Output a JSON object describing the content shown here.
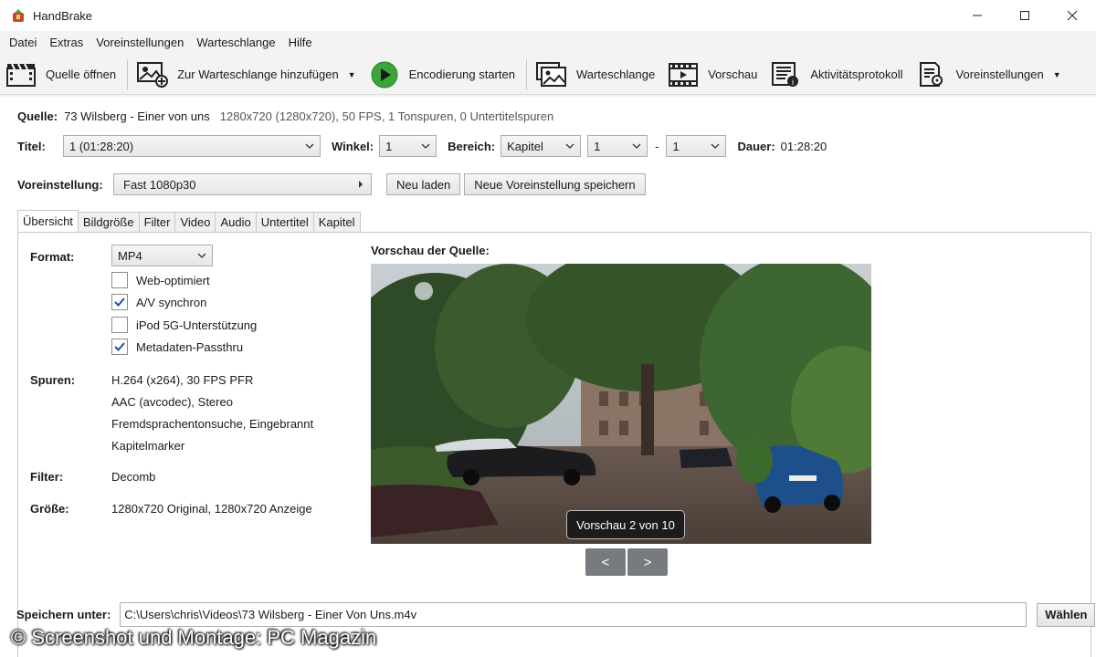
{
  "window": {
    "title": "HandBrake",
    "minimize_icon": "minimize-icon",
    "maximize_icon": "maximize-icon",
    "close_icon": "close-icon"
  },
  "menu": [
    "Datei",
    "Extras",
    "Voreinstellungen",
    "Warteschlange",
    "Hilfe"
  ],
  "toolbar": {
    "open_source": "Quelle öffnen",
    "add_queue": "Zur Warteschlange hinzufügen",
    "start_encode": "Encodierung starten",
    "queue": "Warteschlange",
    "preview": "Vorschau",
    "activity_log": "Aktivitätsprotokoll",
    "presets": "Voreinstellungen",
    "start_color": "#3aa53a"
  },
  "source": {
    "label": "Quelle:",
    "name": "73 Wilsberg - Einer von uns",
    "info": "1280x720 (1280x720), 50 FPS, 1 Tonspuren, 0 Untertitelspuren"
  },
  "title_row": {
    "title_label": "Titel:",
    "title_value": "1  (01:28:20)",
    "angle_label": "Winkel:",
    "angle_value": "1",
    "range_label": "Bereich:",
    "range_type": "Kapitel",
    "range_from": "1",
    "range_dash": "-",
    "range_to": "1",
    "duration_label": "Dauer:",
    "duration_value": "01:28:20"
  },
  "preset_row": {
    "label": "Voreinstellung:",
    "value": "Fast 1080p30",
    "reload": "Neu laden",
    "save_new": "Neue Voreinstellung speichern"
  },
  "tabs": [
    "Übersicht",
    "Bildgröße",
    "Filter",
    "Video",
    "Audio",
    "Untertitel",
    "Kapitel"
  ],
  "summary": {
    "format_label": "Format:",
    "format_value": "MP4",
    "options": [
      {
        "label": "Web-optimiert",
        "checked": false
      },
      {
        "label": "A/V synchron",
        "checked": true
      },
      {
        "label": "iPod 5G-Unterstützung",
        "checked": false
      },
      {
        "label": "Metadaten-Passthru",
        "checked": true
      }
    ],
    "tracks_label": "Spuren:",
    "tracks": [
      "H.264 (x264), 30 FPS PFR",
      "AAC (avcodec), Stereo",
      "Fremdsprachentonsuche, Eingebrannt",
      "Kapitelmarker"
    ],
    "filter_label": "Filter:",
    "filter_value": "Decomb",
    "size_label": "Größe:",
    "size_value": "1280x720 Original, 1280x720 Anzeige",
    "preview_title": "Vorschau der Quelle:",
    "preview_badge": "Vorschau 2 von 10",
    "prev": "<",
    "next": ">"
  },
  "save": {
    "label": "Speichern unter:",
    "path": "C:\\Users\\chris\\Videos\\73 Wilsberg - Einer Von Uns.m4v",
    "browse": "Wählen"
  },
  "watermark": "© Screenshot und Montage: PC Magazin"
}
